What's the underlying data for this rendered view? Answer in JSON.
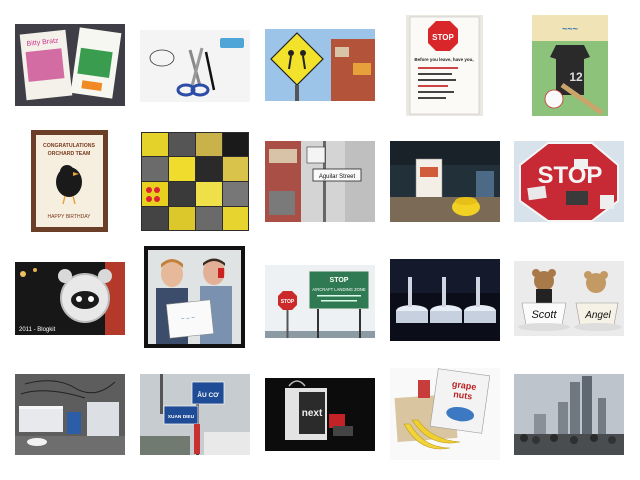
{
  "gallery": {
    "tiles": [
      {
        "subject": "colorful-books",
        "caption": "",
        "texts": [
          "Bitty Bratz"
        ]
      },
      {
        "subject": "scissors-and-pen",
        "caption": "",
        "texts": []
      },
      {
        "subject": "school-crossing-sign",
        "caption": "",
        "texts": []
      },
      {
        "subject": "stop-sign-poster",
        "caption": "",
        "texts": [
          "STOP",
          "Before you leave, have you,"
        ]
      },
      {
        "subject": "baseball-cake",
        "caption": "",
        "texts": [
          "12"
        ]
      },
      {
        "subject": "congratulations-cake",
        "caption": "",
        "texts": [
          "CONGRATULATIONS",
          "ORCHARD TEAM",
          "HAPPY BIRTHDAY"
        ]
      },
      {
        "subject": "yellow-object-collage",
        "caption": "",
        "texts": []
      },
      {
        "subject": "street-sign",
        "caption": "",
        "texts": [
          "Aguilar Street"
        ]
      },
      {
        "subject": "poster-and-yellow-cup",
        "caption": "",
        "texts": []
      },
      {
        "subject": "stop-sign-with-stickers",
        "caption": "",
        "texts": [
          "STOP"
        ]
      },
      {
        "subject": "alarm-clock",
        "caption": "2011 - Blogkit",
        "texts": []
      },
      {
        "subject": "two-men-with-sign",
        "caption": "",
        "texts": []
      },
      {
        "subject": "stop-aircraft-sign",
        "caption": "",
        "texts": [
          "STOP",
          "AIRCRAFT LANDING ZONE"
        ]
      },
      {
        "subject": "display-pedestals",
        "caption": "",
        "texts": []
      },
      {
        "subject": "teddy-bears-in-cups",
        "caption": "",
        "texts": [
          "Scott",
          "Angel"
        ]
      },
      {
        "subject": "game-consoles",
        "caption": "",
        "texts": []
      },
      {
        "subject": "street-name-signs",
        "caption": "",
        "texts": [
          "XUAN DIEU",
          "ÂU CƠ"
        ]
      },
      {
        "subject": "next-shopping-bag",
        "caption": "",
        "texts": [
          "next"
        ]
      },
      {
        "subject": "grape-nuts-and-bananas",
        "caption": "",
        "texts": [
          "grape",
          "nuts"
        ]
      },
      {
        "subject": "city-skyline",
        "caption": "",
        "texts": []
      }
    ]
  }
}
